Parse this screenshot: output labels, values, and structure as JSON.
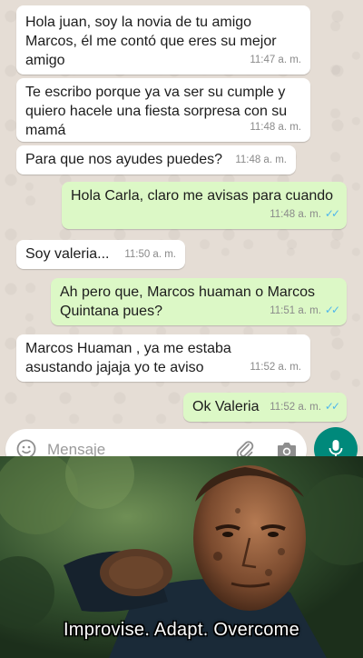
{
  "messages": [
    {
      "dir": "in",
      "text": "Hola juan, soy la novia de tu amigo\nMarcos, él me contó que eres su mejor\namigo",
      "time": "11:47 a. m."
    },
    {
      "dir": "in",
      "text": "Te escribo porque ya va ser su cumple y\nquiero hacele una fiesta sorpresa con su\nmamá",
      "time": "11:48 a. m."
    },
    {
      "dir": "in",
      "text": "Para que nos ayudes puedes?",
      "time": "11:48 a. m."
    },
    {
      "dir": "out",
      "text": "Hola Carla, claro me avisas para cuando",
      "time": "11:48 a. m."
    },
    {
      "dir": "in",
      "text": "Soy valeria...",
      "time": "11:50 a. m."
    },
    {
      "dir": "out",
      "text": "Ah pero que, Marcos huaman o Marcos\nQuintana pues?",
      "time": "11:51 a. m."
    },
    {
      "dir": "in",
      "text": "Marcos Huaman , ya me estaba\nasustando jajaja yo te aviso",
      "time": "11:52 a. m."
    },
    {
      "dir": "out",
      "text": "Ok Valeria",
      "time": "11:52 a. m."
    }
  ],
  "input": {
    "placeholder": "Mensaje"
  },
  "icons": {
    "emoji": "emoji-icon",
    "attach": "paperclip-icon",
    "camera": "camera-icon",
    "mic": "microphone-icon",
    "read": "double-check-icon"
  },
  "colors": {
    "chat_bg": "#e5ddd5",
    "incoming": "#ffffff",
    "outgoing": "#dcf8c6",
    "accent": "#00897b",
    "ticks": "#4fb6ec"
  },
  "meme": {
    "caption": "Improvise. Adapt. Overcome"
  }
}
